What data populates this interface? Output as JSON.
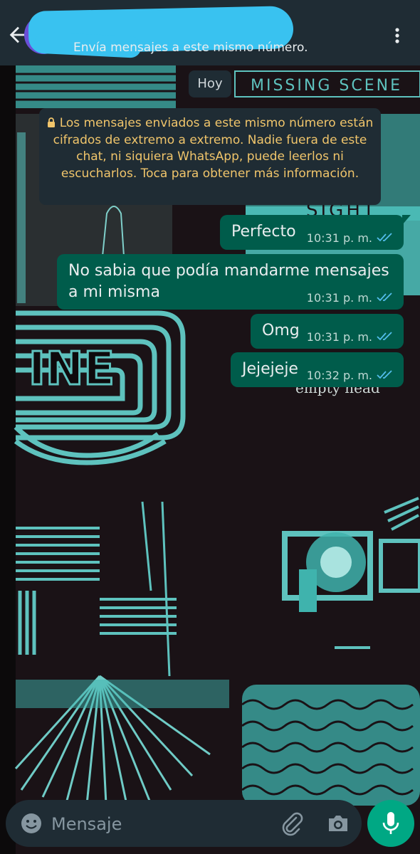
{
  "header": {
    "subtitle": "Envía mensajes a este mismo número."
  },
  "chat": {
    "date_chip": "Hoy",
    "notice": "Los mensajes enviados a este mismo número están cifrados de extremo a extremo. Nadie fuera de este chat, ni siquiera WhatsApp, puede leerlos ni escucharlos. Toca para obtener más información.",
    "messages": [
      {
        "text": "Perfecto",
        "time": "10:31 p. m."
      },
      {
        "text_line1": "No sabia que podía mandarme mensajes",
        "text_line2": "a mi misma",
        "time": "10:31 p. m."
      },
      {
        "text": "Omg",
        "time": "10:31 p. m."
      },
      {
        "text": "Jejejeje",
        "time": "10:32 p. m."
      }
    ],
    "wallpaper_text": {
      "missing": "MISSING SCENE",
      "sight": "SIGHT",
      "ine": "INE",
      "empty": "empty head"
    }
  },
  "composer": {
    "placeholder": "Mensaje"
  },
  "icons": {
    "back": "back-arrow-icon",
    "more": "more-vert-icon",
    "lock": "lock-icon",
    "ticks": "double-check-icon",
    "emoji": "emoji-icon",
    "attach": "paperclip-icon",
    "camera": "camera-icon",
    "mic": "microphone-icon"
  },
  "colors": {
    "header": "#1f2c34",
    "bubble_out": "#005c4b",
    "notice_text": "#f0c56b",
    "read_ticks": "#53bdeb",
    "accent": "#00a884",
    "wallpaper_teal": "#3fb3ad"
  }
}
